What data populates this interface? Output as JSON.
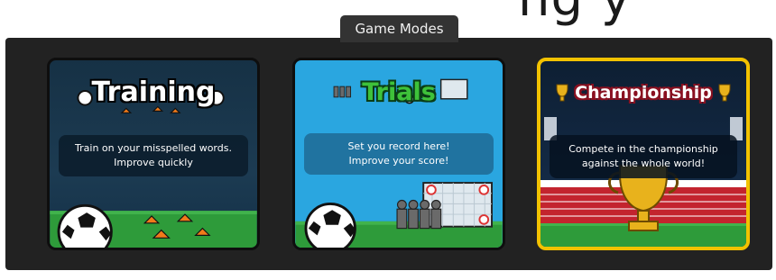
{
  "background": {
    "partial_heading": "ng  y"
  },
  "panel": {
    "tab_label": "Game Modes"
  },
  "modes": [
    {
      "title": "Training",
      "description": "Train on your misspelled words. Improve quickly"
    },
    {
      "title": "Trials",
      "description": "Set you record here!\nImprove your score!"
    },
    {
      "title": "Championship",
      "description": "Compete in the championship against the whole world!"
    }
  ],
  "colors": {
    "panel": "#222222",
    "tab": "#333333",
    "training_bg": "#163145",
    "trials_bg": "#2aa6e0",
    "champ_border": "#f2c200",
    "grass": "#2e9b3a"
  }
}
